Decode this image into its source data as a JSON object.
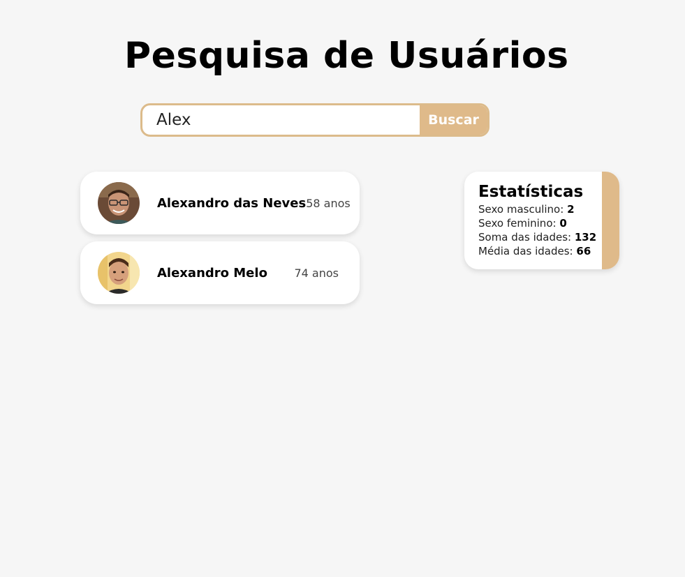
{
  "title": "Pesquisa de Usuários",
  "search": {
    "value": "Alex",
    "button_label": "Buscar"
  },
  "users": [
    {
      "name": "Alexandro das Neves",
      "age": "58 anos"
    },
    {
      "name": "Alexandro Melo",
      "age": "74 anos"
    }
  ],
  "stats": {
    "title": "Estatísticas",
    "male_label": "Sexo masculino: ",
    "male_value": "2",
    "female_label": "Sexo feminino: ",
    "female_value": "0",
    "age_sum_label": "Soma das idades: ",
    "age_sum_value": "132",
    "age_avg_label": "Média das idades: ",
    "age_avg_value": "66"
  },
  "colors": {
    "accent": "#dfba8a",
    "background": "#f6f6f6"
  }
}
